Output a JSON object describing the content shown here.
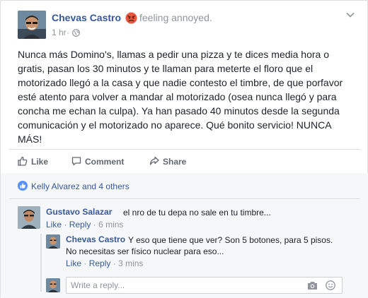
{
  "post": {
    "author": "Chevas Castro",
    "feeling_text": "feeling annoyed.",
    "feeling_icon": "angry-face-icon",
    "time": "1 hr",
    "dot": "·",
    "audience_icon": "globe-icon",
    "text_lines": [
      "Nunca más Domino's, llamas a pedir una pizza y te dices media hora o",
      "gratis, pasan los 30 minutos y te llaman para meterte el floro que el",
      "motorizado llegó a la casa y que nadie contesto el timbre, de que porfavor",
      "esté atento para volver a mandar al motorizado (osea nunca llegó y para",
      "concha me echan la culpa). Ya han pasado 40 minutos desde la segunda",
      "comunicación y el motorizado no aparece. Qué bonito servicio! NUNCA",
      "MÁS!"
    ]
  },
  "actions": {
    "like": "Like",
    "comment": "Comment",
    "share": "Share"
  },
  "reactions": {
    "text": "Kelly Alvarez and 4 others"
  },
  "comments": [
    {
      "author": "Gustavo Salazar",
      "text": "el nro de tu depa no sale en tu timbre...",
      "like": "Like",
      "sep": "·",
      "reply": "Reply",
      "time": "6 mins"
    }
  ],
  "replies": [
    {
      "author": "Chevas Castro",
      "text_line1": "Y eso que tiene que ver? Son 5 botones, para 5 pisos.",
      "text_line2": "No necesitas ser físico nuclear para eso...",
      "like": "Like",
      "sep": "·",
      "reply": "Reply",
      "time": "3 mins"
    }
  ],
  "reply_box": {
    "placeholder": "Write a reply..."
  },
  "colors": {
    "link": "#365899",
    "meta": "#90949c",
    "like_blue": "#5890ff",
    "angry_red": "#e9573f"
  }
}
